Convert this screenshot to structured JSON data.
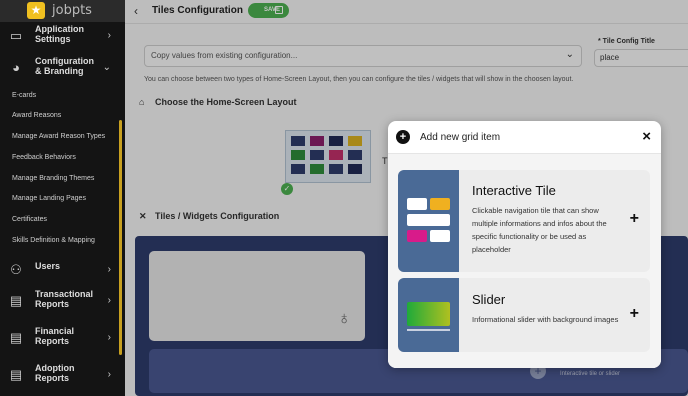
{
  "app": {
    "logo_text": "jobpts"
  },
  "sidebar": {
    "items": [
      {
        "label": "Application Settings",
        "icon": "monitor-icon",
        "chevron": "›"
      },
      {
        "label": "Configuration & Branding",
        "icon": "palette-icon",
        "chevron": "⌄"
      },
      {
        "label": "Users",
        "icon": "users-icon",
        "chevron": "›"
      },
      {
        "label": "Transactional Reports",
        "icon": "file-icon",
        "chevron": "›"
      },
      {
        "label": "Financial Reports",
        "icon": "file-icon",
        "chevron": "›"
      },
      {
        "label": "Adoption Reports",
        "icon": "file-icon",
        "chevron": "›"
      }
    ],
    "subitems": [
      "E-cards",
      "Award Reasons",
      "Manage Award Reason Types",
      "Feedback Behaviors",
      "Manage Branding Themes",
      "Manage Landing Pages",
      "Certificates",
      "Skills Definition & Mapping"
    ]
  },
  "header": {
    "back": "‹",
    "title": "Tiles Configuration",
    "save_label": "SAVE"
  },
  "form": {
    "copy_placeholder": "Copy values from existing configuration...",
    "tile_config_label": "* Tile Config Title",
    "tile_config_value": "place",
    "hint": "You can choose between two types of Home-Screen Layout, then you can configure the tiles / widgets that will show in the choosen layout."
  },
  "sections": {
    "layout_title": "Choose the Home-Screen Layout",
    "layout_thumb_label": "T",
    "widgets_title": "Tiles / Widgets Configuration",
    "add_tile_hint": "Interactive tile or slider"
  },
  "modal": {
    "title": "Add new grid item",
    "close": "×",
    "cards": [
      {
        "title": "Interactive Tile",
        "description": "Clickable navigation tile that can show multiple informations and infos about the specific functionality or be used as placeholder",
        "action": "+"
      },
      {
        "title": "Slider",
        "description": "Informational slider with background images",
        "action": "+"
      }
    ]
  },
  "colors": {
    "sidebar_bg": "#141414",
    "accent": "#f0c020",
    "save_green": "#4caf50",
    "config_area": "#2d3b6b",
    "card_thumb": "#4a6a96"
  }
}
